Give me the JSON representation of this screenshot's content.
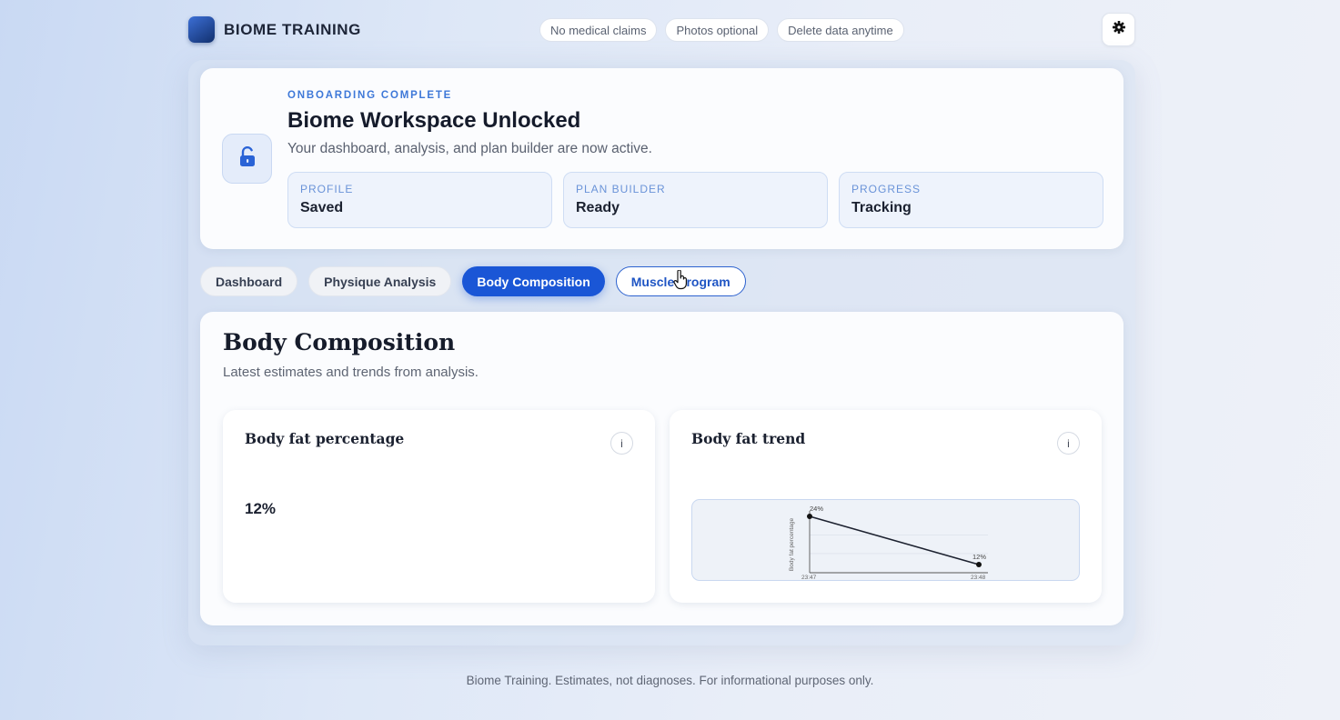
{
  "brand": {
    "name": "BIOME TRAINING"
  },
  "top_pills": [
    "No medical claims",
    "Photos optional",
    "Delete data anytime"
  ],
  "onboarding": {
    "eyebrow": "ONBOARDING COMPLETE",
    "title": "Biome Workspace Unlocked",
    "subtitle": "Your dashboard, analysis, and plan builder are now active.",
    "status_cards": [
      {
        "label": "PROFILE",
        "value": "Saved"
      },
      {
        "label": "PLAN BUILDER",
        "value": "Ready"
      },
      {
        "label": "PROGRESS",
        "value": "Tracking"
      }
    ]
  },
  "tabs": [
    {
      "label": "Dashboard",
      "state": "plain"
    },
    {
      "label": "Physique Analysis",
      "state": "plain"
    },
    {
      "label": "Body Composition",
      "state": "active"
    },
    {
      "label": "Muscle Program",
      "state": "hover"
    }
  ],
  "body_composition": {
    "title": "Body Composition",
    "subtitle": "Latest estimates and trends from analysis.",
    "fat_card": {
      "title": "Body fat percentage",
      "info": "i",
      "value": "12%"
    },
    "trend_card": {
      "title": "Body fat trend",
      "info": "i"
    }
  },
  "chart_data": {
    "type": "line",
    "x": [
      "23:47",
      "23:48"
    ],
    "series": [
      {
        "values": [
          24,
          12
        ]
      }
    ],
    "data_labels": [
      "24%",
      "12%"
    ],
    "ylabel": "Body fat percentage",
    "xlabel": "",
    "ylim": [
      12,
      24
    ],
    "grid": true
  },
  "footer": "Biome Training. Estimates, not diagnoses. For informational purposes only.",
  "colors": {
    "accent": "#1a56d6",
    "eyebrow": "#3e78d8",
    "status_label": "#6a93d8"
  },
  "icons": {
    "settings": "gear-icon",
    "lock": "unlock-icon",
    "cursor": "hand-pointer-icon"
  }
}
